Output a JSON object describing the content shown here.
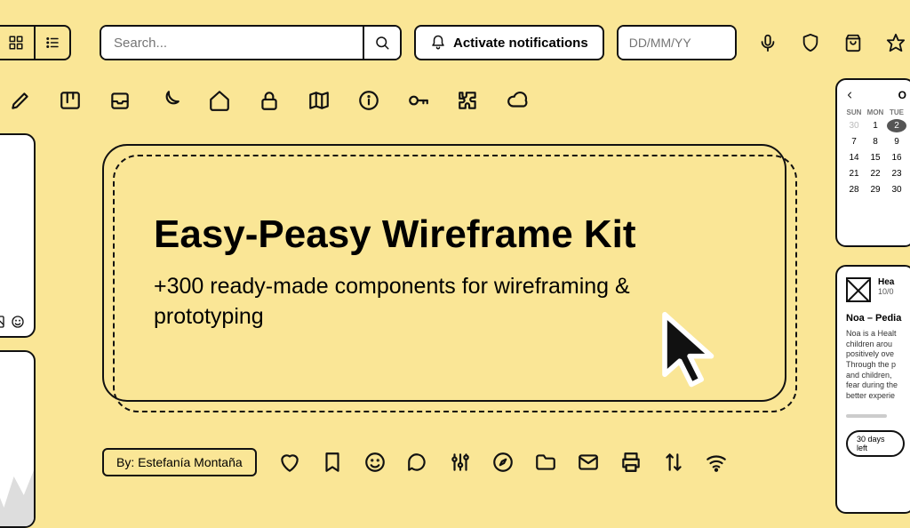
{
  "topbar": {
    "search_placeholder": "Search...",
    "notif_label": "Activate notifications",
    "date_placeholder": "DD/MM/YY"
  },
  "hero": {
    "title": "Easy-Peasy Wireframe Kit",
    "subtitle": "+300 ready-made components for wireframing & prototyping"
  },
  "byline": {
    "prefix": "By:",
    "author": "Estefanía Montaña"
  },
  "calendar": {
    "month_initial": "O",
    "day_headers": [
      "SUN",
      "MON",
      "TUE"
    ],
    "weeks": [
      [
        {
          "n": 30,
          "muted": true
        },
        {
          "n": 1
        },
        {
          "n": 2,
          "sel": true
        }
      ],
      [
        {
          "n": 7
        },
        {
          "n": 8
        },
        {
          "n": 9
        }
      ],
      [
        {
          "n": 14
        },
        {
          "n": 15
        },
        {
          "n": 16
        }
      ],
      [
        {
          "n": 21
        },
        {
          "n": 22
        },
        {
          "n": 23
        }
      ],
      [
        {
          "n": 28
        },
        {
          "n": 29
        },
        {
          "n": 30
        }
      ]
    ]
  },
  "widget": {
    "top_title": "Hea",
    "top_date": "10/0",
    "title": "Noa – Pedia",
    "body": "Noa is a Healt children arou positively ove Through the p and children, fear during the better experie",
    "pill": "30 days left"
  }
}
